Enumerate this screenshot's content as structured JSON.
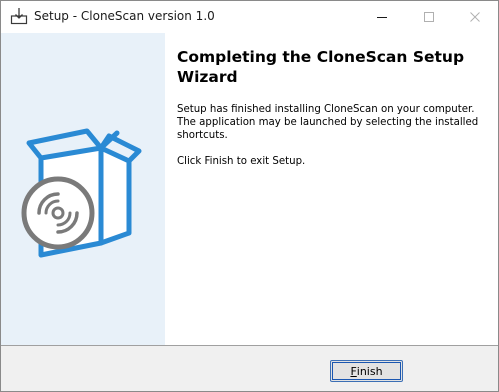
{
  "window": {
    "title": "Setup - CloneScan version 1.0",
    "icon": "setup-installer-icon",
    "controls": [
      "minimize-icon",
      "maximize-icon",
      "close-icon"
    ]
  },
  "sidebar": {
    "illustration": "box-with-disc-icon",
    "accent_color": "#2a8ad4",
    "background_color": "#e8f1f9"
  },
  "main": {
    "heading": "Completing the CloneScan Setup Wizard",
    "paragraph1": "Setup has finished installing CloneScan on your computer. The application may be launched by selecting the installed shortcuts.",
    "paragraph2": "Click Finish to exit Setup."
  },
  "footer": {
    "finish_label_mnemonic": "F",
    "finish_label_rest": "inish"
  }
}
